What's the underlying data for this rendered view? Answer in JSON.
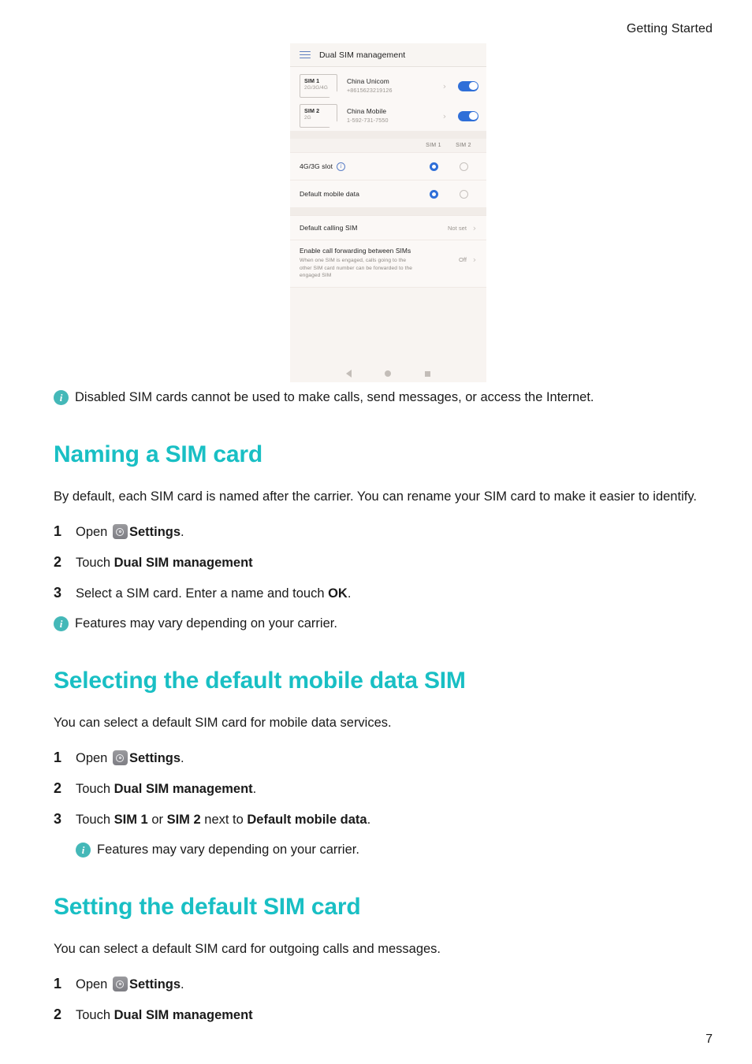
{
  "page": {
    "running_head": "Getting Started",
    "page_number": "7"
  },
  "phone_screenshot": {
    "appbar": {
      "menu_icon": "hamburger-menu-icon",
      "title": "Dual SIM management"
    },
    "sim_cards": [
      {
        "slot_label": "SIM 1",
        "generations": "2G/3G/4G",
        "carrier": "China Unicom",
        "number": "+8615623219126",
        "enabled": true
      },
      {
        "slot_label": "SIM 2",
        "generations": "2G",
        "carrier": "China Mobile",
        "number": "1-592-731-7550",
        "enabled": true
      }
    ],
    "columns": {
      "sim1": "SIM 1",
      "sim2": "SIM 2"
    },
    "radio_rows": [
      {
        "label": "4G/3G slot",
        "has_info_icon": true,
        "sim1_selected": true,
        "sim2_selected": false
      },
      {
        "label": "Default mobile data",
        "has_info_icon": false,
        "sim1_selected": true,
        "sim2_selected": false
      }
    ],
    "default_calling": {
      "label": "Default calling SIM",
      "value": "Not set"
    },
    "call_forwarding": {
      "title": "Enable call forwarding between SIMs",
      "description": "When one SIM is engaged, calls going to the other SIM card number can be forwarded to the engaged SIM",
      "value": "Off"
    },
    "navbar": {
      "back": "back-nav-icon",
      "home": "home-nav-icon",
      "recents": "recents-nav-icon"
    }
  },
  "content": {
    "top_note": "Disabled SIM cards cannot be used to make calls, send messages, or access the Internet.",
    "sections": [
      {
        "heading": "Naming a SIM card",
        "intro": "By default, each SIM card is named after the carrier. You can rename your SIM card to make it easier to identify.",
        "steps": [
          {
            "num": "1",
            "pre": "Open ",
            "icon": "settings-app-icon",
            "bold": "Settings",
            "post": "."
          },
          {
            "num": "2",
            "pre": "Touch ",
            "icon": null,
            "bold": "Dual SIM management",
            "post": ""
          },
          {
            "num": "3",
            "pre": "Select a SIM card. Enter a name and touch ",
            "icon": null,
            "bold": "OK",
            "post": "."
          }
        ],
        "note": "Features may vary depending on your carrier.",
        "note_indented": false
      },
      {
        "heading": "Selecting the default mobile data SIM",
        "intro": "You can select a default SIM card for mobile data services.",
        "steps": [
          {
            "num": "1",
            "pre": "Open ",
            "icon": "settings-app-icon",
            "bold": "Settings",
            "post": "."
          },
          {
            "num": "2",
            "pre": "Touch ",
            "icon": null,
            "bold": "Dual SIM management",
            "post": "."
          },
          {
            "num": "3",
            "pre": "Touch ",
            "icon": null,
            "bold": "SIM 1",
            "mid": " or ",
            "bold2": "SIM 2",
            "mid2": " next to ",
            "bold3": "Default mobile data",
            "post": "."
          }
        ],
        "note": "Features may vary depending on your carrier.",
        "note_indented": true
      },
      {
        "heading": "Setting the default SIM card",
        "intro": "You can select a default SIM card for outgoing calls and messages.",
        "steps": [
          {
            "num": "1",
            "pre": "Open ",
            "icon": "settings-app-icon",
            "bold": "Settings",
            "post": "."
          },
          {
            "num": "2",
            "pre": "Touch ",
            "icon": null,
            "bold": "Dual SIM management",
            "post": ""
          }
        ],
        "note": null,
        "note_indented": false
      }
    ]
  },
  "colors": {
    "heading_teal": "#19bfc4",
    "note_icon_teal": "#44b8b8",
    "toggle_blue": "#2f6fd8",
    "radio_blue": "#2f6fd8"
  }
}
